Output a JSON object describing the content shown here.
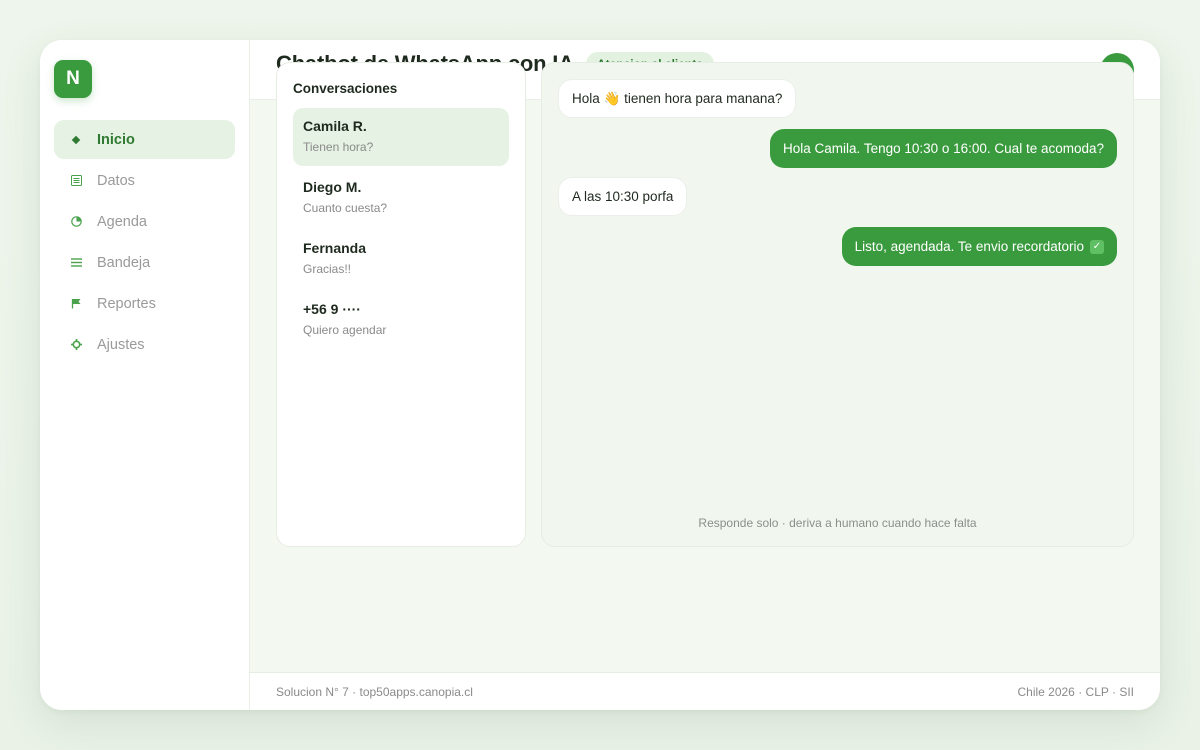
{
  "app": {
    "logo_letter": "N",
    "title": "Chatbot de WhatsApp con IA",
    "badge": "Atencion al cliente",
    "accent_color": "#3a9b3e"
  },
  "sidebar": {
    "items": [
      {
        "label": "Inicio",
        "icon": "diamond-icon",
        "active": true
      },
      {
        "label": "Datos",
        "icon": "table-icon",
        "active": false
      },
      {
        "label": "Agenda",
        "icon": "clock-icon",
        "active": false
      },
      {
        "label": "Bandeja",
        "icon": "list-icon",
        "active": false
      },
      {
        "label": "Reportes",
        "icon": "flag-icon",
        "active": false
      },
      {
        "label": "Ajustes",
        "icon": "gear-icon",
        "active": false
      }
    ]
  },
  "conversations": {
    "heading": "Conversaciones",
    "items": [
      {
        "name": "Camila R.",
        "preview": "Tienen hora?",
        "active": true
      },
      {
        "name": "Diego M.",
        "preview": "Cuanto cuesta?",
        "active": false
      },
      {
        "name": "Fernanda",
        "preview": "Gracias!!",
        "active": false
      },
      {
        "name": "+56 9 ····",
        "preview": "Quiero agendar",
        "active": false
      }
    ]
  },
  "chat": {
    "messages": [
      {
        "direction": "in",
        "text": "Hola 👋 tienen hora para manana?"
      },
      {
        "direction": "out",
        "text": "Hola Camila. Tengo 10:30 o 16:00. Cual te acomoda?"
      },
      {
        "direction": "in",
        "text": "A las 10:30 porfa"
      },
      {
        "direction": "out",
        "text": "Listo, agendada. Te envio recordatorio",
        "check_mark": "✓"
      }
    ],
    "footer_note": "Responde solo · deriva a humano cuando hace falta"
  },
  "footer": {
    "left": "Solucion N° 7 · top50apps.canopia.cl",
    "right": "Chile 2026 · CLP · SII"
  }
}
